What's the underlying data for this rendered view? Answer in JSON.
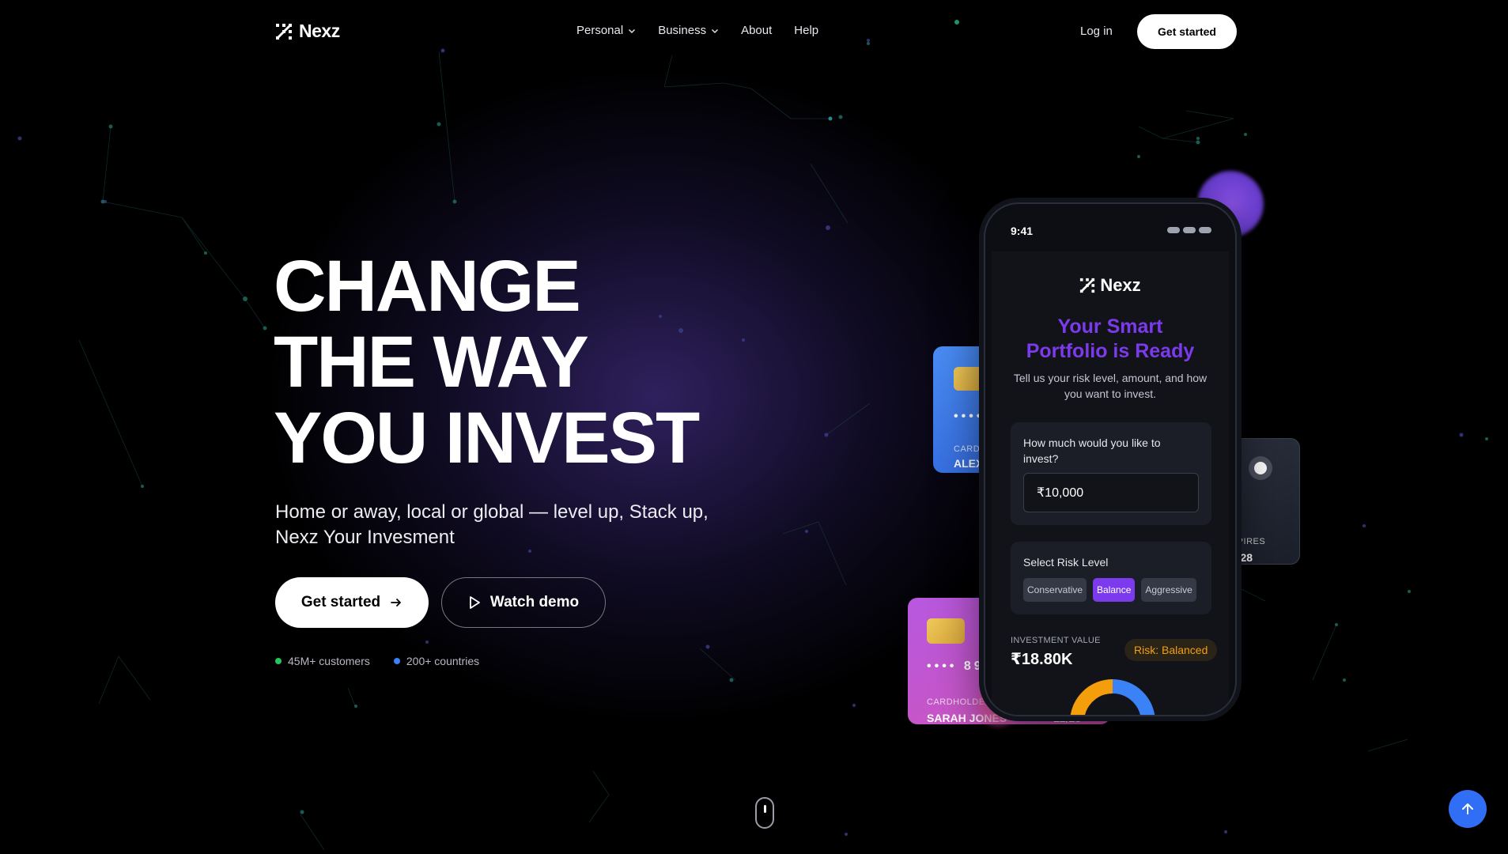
{
  "brand": {
    "name": "Nexz"
  },
  "nav": {
    "links": [
      {
        "label": "Personal",
        "has_dropdown": true
      },
      {
        "label": "Business",
        "has_dropdown": true
      },
      {
        "label": "About",
        "has_dropdown": false
      },
      {
        "label": "Help",
        "has_dropdown": false
      }
    ],
    "login_label": "Log in",
    "cta_label": "Get started"
  },
  "hero": {
    "title_lines": [
      "CHANGE",
      "THE WAY",
      "YOU INVEST"
    ],
    "subtitle": "Home or away, local or global — level up, Stack up, Nexz Your Invesment",
    "primary_button": "Get started",
    "secondary_button": "Watch demo",
    "stats": [
      {
        "label": "45M+ customers",
        "color": "#22c55e"
      },
      {
        "label": "200+ countries",
        "color": "#3b82f6"
      }
    ]
  },
  "cards": {
    "blue": {
      "number_partial": "••••",
      "label_partial": "CARDH",
      "name_partial": "ALEX S"
    },
    "dark": {
      "expires_label": "EXPIRES",
      "expires_value": "12/28"
    },
    "pink": {
      "number_partial": "•••• 89",
      "holder_label": "CARDHOLDER",
      "holder_name": "SARAH JONES",
      "expiry": "12/28"
    }
  },
  "phone": {
    "time": "9:41",
    "logo_text": "Nexz",
    "title": "Your Smart Portfolio is Ready",
    "description": "Tell us your risk level, amount, and how you want to invest.",
    "amount_question": "How much would you like to invest?",
    "amount_value": "₹10,000",
    "risk_label": "Select Risk Level",
    "risk_options": [
      "Conservative",
      "Balance",
      "Aggressive"
    ],
    "risk_selected": "Balance",
    "investment_value_label": "INVESTMENT VALUE",
    "investment_value": "₹18.80K",
    "risk_badge": "Risk: Balanced"
  },
  "colors": {
    "accent_purple": "#7c3aed",
    "accent_blue": "#2f6ef5",
    "badge_orange": "#f59e0b"
  }
}
